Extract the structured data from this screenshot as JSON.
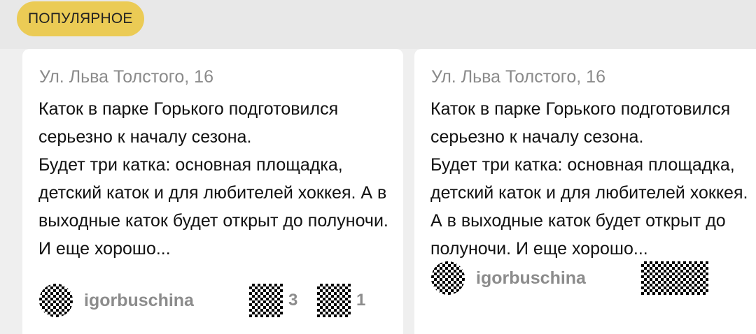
{
  "header": {
    "tag_label": "ПОПУЛЯРНОЕ",
    "tag_color": "#ebcb55"
  },
  "cards": [
    {
      "address": "Ул. Льва Толстого, 16",
      "text": "Каток в парке Горького подготовился серьезно к началу сезона.\nБудет три катка: основная площадка, детский каток и для любителей хоккея. А в выходные каток будет открыт до полуночи. И еще хорошо...",
      "author": "igorbuschina",
      "avatar_icon": "avatar-image",
      "likes_icon": "like-icon",
      "likes_count": "3",
      "comments_icon": "comment-icon",
      "comments_count": "1"
    },
    {
      "address": "Ул. Льва Толстого, 16",
      "text": "Каток в парке Горького подготовился серьезно к началу сезона.\nБудет три катка: основная площадка, детский каток и для любителей хоккея. А в выходные каток будет открыт до полуночи. И еще хорошо...",
      "author": "igorbuschina",
      "avatar_icon": "avatar-image",
      "stats_icon": "stats-icons"
    }
  ]
}
